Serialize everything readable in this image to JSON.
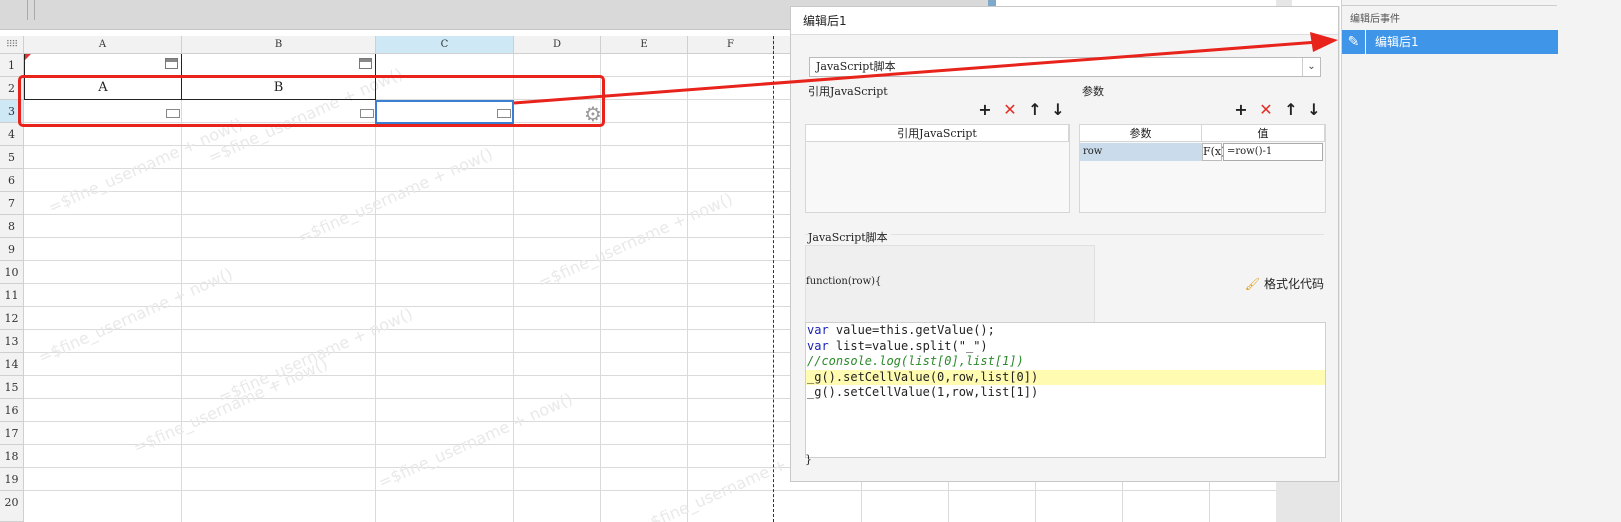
{
  "sheet": {
    "columns": [
      "A",
      "B",
      "C",
      "D",
      "E",
      "F"
    ],
    "rows": [
      "1",
      "2",
      "3",
      "4",
      "5",
      "6",
      "7",
      "8",
      "9",
      "10",
      "11",
      "12",
      "13",
      "14",
      "15",
      "16",
      "17",
      "18",
      "19",
      "20"
    ],
    "cell_a2": "A",
    "cell_b2": "B",
    "watermark": "=$fine_username + now()"
  },
  "dialog": {
    "title": "编辑后1",
    "script_type": "JavaScript脚本",
    "ref_js_label": "引用JavaScript",
    "params_label": "参数",
    "ref_js_col": "引用JavaScript",
    "param_col": "参数",
    "value_col": "值",
    "param_row": {
      "name": "row",
      "fx": "F(x)",
      "value": "=row()-1"
    },
    "js_section_label": "JavaScript脚本",
    "function_header": "function(row){",
    "format_code": "格式化代码",
    "code_lines": [
      "var value=this.getValue();",
      "var list=value.split(\"_\")",
      "//console.log(list[0],list[1])",
      "_g().setCellValue(0,row,list[0])",
      "_g().setCellValue(1,row,list[1])"
    ],
    "function_close": "}"
  },
  "events_panel": {
    "header": "编辑后事件",
    "item": "编辑后1"
  },
  "colors": {
    "accent": "#3f95e8",
    "annotation_red": "#e8231b",
    "selection": "#3a7fd1"
  }
}
